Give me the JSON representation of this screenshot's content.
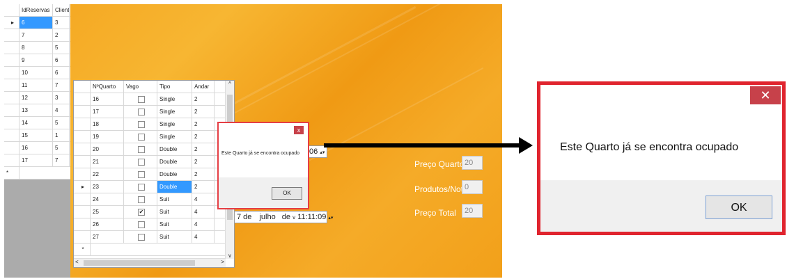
{
  "reservas_grid": {
    "headers": [
      "IdReservas",
      "Cliente"
    ],
    "rows": [
      [
        "6",
        "3"
      ],
      [
        "7",
        "2"
      ],
      [
        "8",
        "5"
      ],
      [
        "9",
        "6"
      ],
      [
        "10",
        "6"
      ],
      [
        "11",
        "7"
      ],
      [
        "12",
        "3"
      ],
      [
        "13",
        "4"
      ],
      [
        "14",
        "5"
      ],
      [
        "15",
        "1"
      ],
      [
        "16",
        "5"
      ],
      [
        "17",
        "7"
      ]
    ],
    "selected_row_index": 0,
    "current_row_marker": "▸",
    "new_row_marker": "*"
  },
  "quartos_grid": {
    "headers": [
      "NºQuarto",
      "Vago",
      "Tipo",
      "Andar"
    ],
    "rows": [
      {
        "num": "16",
        "vago": "",
        "tipo": "Single",
        "andar": "2"
      },
      {
        "num": "17",
        "vago": "",
        "tipo": "Single",
        "andar": "2"
      },
      {
        "num": "18",
        "vago": "",
        "tipo": "Single",
        "andar": "2"
      },
      {
        "num": "19",
        "vago": "",
        "tipo": "Single",
        "andar": "2"
      },
      {
        "num": "20",
        "vago": "",
        "tipo": "Double",
        "andar": "2"
      },
      {
        "num": "21",
        "vago": "",
        "tipo": "Double",
        "andar": "2"
      },
      {
        "num": "22",
        "vago": "",
        "tipo": "Double",
        "andar": "2"
      },
      {
        "num": "23",
        "vago": "",
        "tipo": "Double",
        "andar": "2"
      },
      {
        "num": "24",
        "vago": "",
        "tipo": "Suit",
        "andar": "4"
      },
      {
        "num": "25",
        "vago": "✔",
        "tipo": "Suit",
        "andar": "4"
      },
      {
        "num": "26",
        "vago": "",
        "tipo": "Suit",
        "andar": "4"
      },
      {
        "num": "27",
        "vago": "",
        "tipo": "Suit",
        "andar": "4"
      }
    ],
    "selected_row_index": 7,
    "new_row_marker": "*"
  },
  "date_picker_top": {
    "value_visible": ":06"
  },
  "date_picker_bottom": {
    "day": "7 de",
    "month": "julho",
    "suffix": "de",
    "time": "11:11:09"
  },
  "fields": {
    "preco_quarto": {
      "label": "Preço Quarto",
      "value": "20"
    },
    "produtos_notas": {
      "label": "Produtos/Notas",
      "value": "0"
    },
    "preco_total": {
      "label": "Preço Total",
      "value": "20"
    }
  },
  "dialog_small": {
    "message": "Este Quarto já se encontra ocupado",
    "ok_label": "OK",
    "close_label": "x"
  },
  "dialog_large": {
    "message": "Este Quarto já se encontra ocupado",
    "ok_label": "OK",
    "close_label": "✕"
  },
  "colors": {
    "background": "#f4a41e",
    "selection": "#3399ff",
    "dialog_border": "#e0242e",
    "close_button": "#c7414a"
  }
}
